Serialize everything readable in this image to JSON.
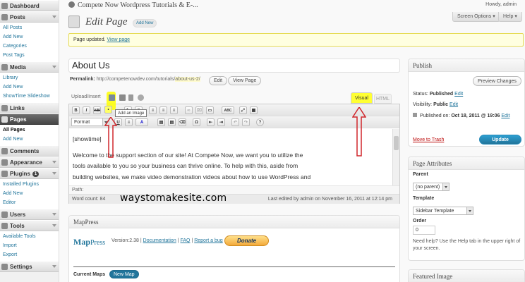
{
  "sidebar": {
    "sections": [
      {
        "label": "Dashboard",
        "icon": "dashboard-icon",
        "items": []
      },
      {
        "label": "Posts",
        "icon": "posts-icon",
        "items": [
          "All Posts",
          "Add New",
          "Categories",
          "Post Tags"
        ]
      },
      {
        "label": "Media",
        "icon": "media-icon",
        "items": [
          "Library",
          "Add New",
          "ShowTime Slideshow"
        ]
      },
      {
        "label": "Links",
        "icon": "links-icon",
        "items": []
      },
      {
        "label": "Pages",
        "icon": "pages-icon",
        "current": true,
        "items": [
          "All Pages",
          "Add New"
        ]
      },
      {
        "label": "Comments",
        "icon": "comments-icon",
        "items": []
      },
      {
        "label": "Appearance",
        "icon": "appearance-icon",
        "items": []
      },
      {
        "label": "Plugins",
        "icon": "plugins-icon",
        "count": "1",
        "items": [
          "Installed Plugins",
          "Add New",
          "Editor"
        ]
      },
      {
        "label": "Users",
        "icon": "users-icon",
        "items": []
      },
      {
        "label": "Tools",
        "icon": "tools-icon",
        "items": [
          "Available Tools",
          "Import",
          "Export"
        ]
      },
      {
        "label": "Settings",
        "icon": "settings-icon",
        "items": []
      }
    ]
  },
  "topbar": {
    "site_title": "Compete Now Wordpress Tutorials & E-...",
    "howdy": "Howdy, admin",
    "screen_options": "Screen Options ▾",
    "help": "Help ▾"
  },
  "header": {
    "title": "Edit Page",
    "add_new": "Add New"
  },
  "notice": {
    "text": "Page updated.",
    "link": "View page"
  },
  "editor": {
    "title_value": "About Us",
    "permalink_label": "Permalink:",
    "permalink_base": "http://competenowdev.com/tutorials/",
    "permalink_slug": "about-us-2/",
    "edit_btn": "Edit",
    "view_page_btn": "View Page",
    "upload_insert": "Upload/Insert",
    "visual_tab": "Visual",
    "html_tab": "HTML",
    "tooltip": "Add an Image",
    "format_select": "Format",
    "toolbar_row1": [
      "B",
      "I",
      "ABC",
      "•",
      "1.",
      "“",
      "≡",
      "≡",
      "≡",
      "∞",
      "⌧",
      "▭",
      "ABC",
      "⤢",
      "▦"
    ],
    "toolbar_row2": [
      "U",
      "≡",
      "A",
      "▤",
      "▤",
      "⌫",
      "Ω",
      "⇤",
      "⇥",
      "↶",
      "↷",
      "?"
    ],
    "content": [
      "[showtime]",
      "Welcome to the support section of our site! At Compete Now, we want you to utilize the",
      "tools available to you so your business can thrive online. To help with this, aside from",
      "building websites, we make video demonstration videos about how to use WordPress and"
    ],
    "path_label": "Path:",
    "word_count": "Word count: 84",
    "last_edited": "Last edited by admin on November 16, 2011 at 12:14 pm"
  },
  "watermark": "waystomakesite.com",
  "mappress": {
    "heading": "MapPress",
    "logo_map": "Map",
    "logo_press": "Press",
    "version": "Version:2.38 |",
    "documentation": "Documentation",
    "faq": "FAQ",
    "report_bug": "Report a bug",
    "sep": "|",
    "donate": "Donate",
    "current_maps": "Current Maps",
    "new_map": "New Map"
  },
  "publish": {
    "heading": "Publish",
    "preview_btn": "Preview Changes",
    "status_label": "Status:",
    "status_value": "Published",
    "visibility_label": "Visibility:",
    "visibility_value": "Public",
    "published_label": "Published on:",
    "published_value": "Oct 18, 2011 @ 19:06",
    "edit": "Edit",
    "trash": "Move to Trash",
    "update": "Update"
  },
  "page_attributes": {
    "heading": "Page Attributes",
    "parent_label": "Parent",
    "parent_value": "(no parent)",
    "template_label": "Template",
    "template_value": "Sidebar Template",
    "order_label": "Order",
    "order_value": "0",
    "help_text": "Need help? Use the Help tab in the upper right of your screen."
  },
  "featured_image": {
    "heading": "Featured Image"
  },
  "colors": {
    "link": "#21759b",
    "highlight": "#ffff00",
    "arrow": "#d0262b",
    "update_btn": "#21759b",
    "trash": "#bc0b0b"
  }
}
